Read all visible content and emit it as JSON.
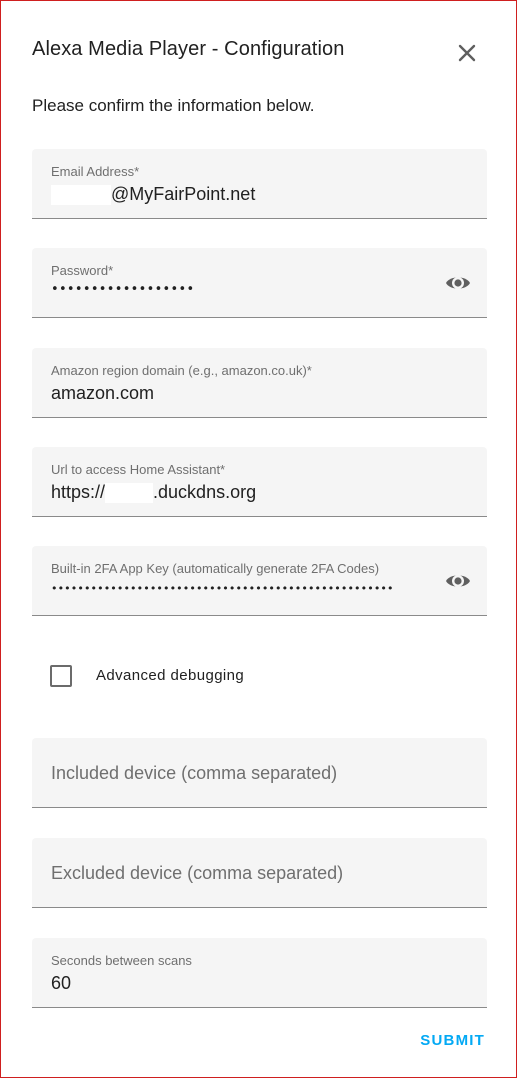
{
  "dialog": {
    "title": "Alexa Media Player - Configuration",
    "description": "Please confirm the information below."
  },
  "fields": {
    "email": {
      "label": "Email Address*",
      "value": "@MyFairPoint.net"
    },
    "password": {
      "label": "Password*",
      "value": "••••••••••••••••••"
    },
    "region": {
      "label": "Amazon region domain (e.g., amazon.co.uk)*",
      "value": "amazon.com"
    },
    "url": {
      "label": "Url to access Home Assistant*",
      "value_prefix": "https://",
      "value_suffix": ".duckdns.org"
    },
    "twofa": {
      "label": "Built-in 2FA App Key (automatically generate 2FA Codes)",
      "value": "••••••••••••••••••••••••••••••••••••••••••••••••••••"
    },
    "included": {
      "placeholder": "Included device (comma separated)"
    },
    "excluded": {
      "placeholder": "Excluded device (comma separated)"
    },
    "scan_interval": {
      "label": "Seconds between scans",
      "value": "60"
    }
  },
  "checkbox": {
    "label": "Advanced debugging",
    "checked": false
  },
  "actions": {
    "submit_label": "SUBMIT"
  },
  "icons": {
    "close": "close-icon",
    "visibility": "eye-icon"
  },
  "colors": {
    "accent": "#03a9f4",
    "field_bg": "#f5f5f5"
  }
}
